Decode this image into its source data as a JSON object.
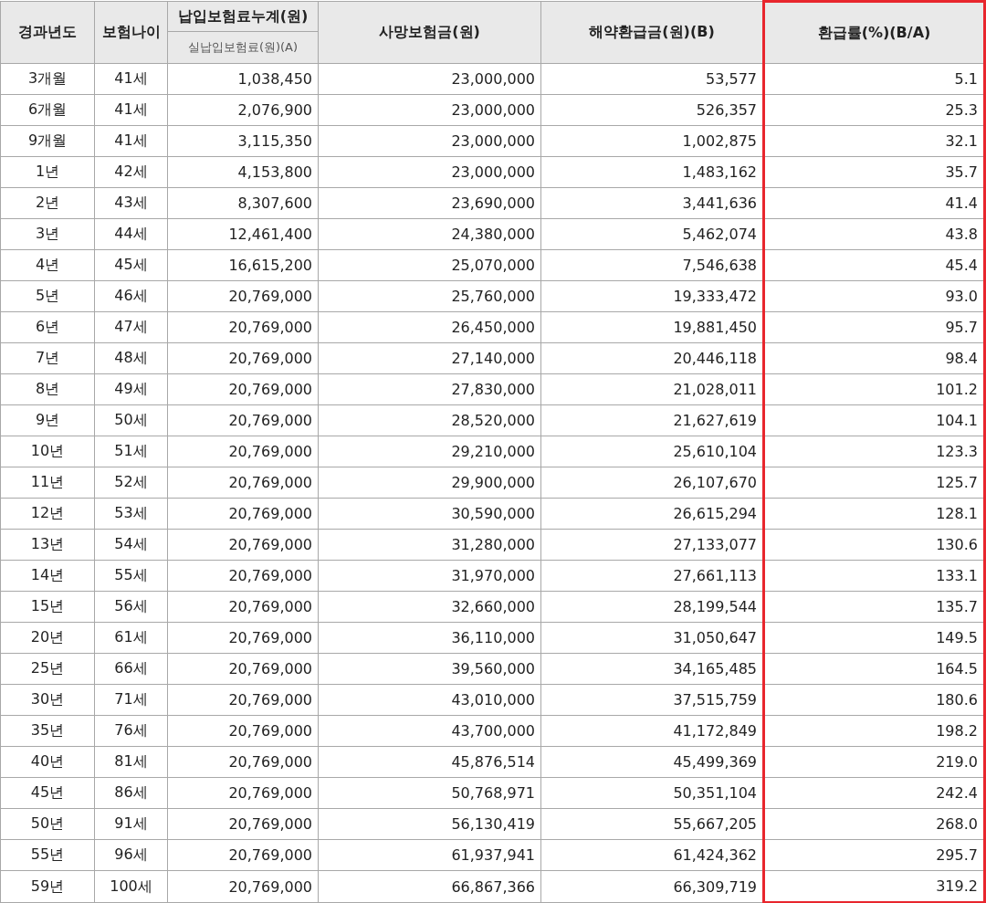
{
  "table": {
    "columns": [
      {
        "label": "경과년도",
        "highlighted": false
      },
      {
        "label": "보험나이",
        "highlighted": false
      },
      {
        "label": "납입보험료누계(원)",
        "sublabel": "실납입보험료(원)(A)",
        "highlighted": false
      },
      {
        "label": "사망보험금(원)",
        "highlighted": false
      },
      {
        "label": "해약환급금(원)(B)",
        "highlighted": false
      },
      {
        "label": "환급률(%)(B/A)",
        "highlighted": true
      }
    ],
    "rows": [
      [
        "3개월",
        "41세",
        "1,038,450",
        "23,000,000",
        "53,577",
        "5.1"
      ],
      [
        "6개월",
        "41세",
        "2,076,900",
        "23,000,000",
        "526,357",
        "25.3"
      ],
      [
        "9개월",
        "41세",
        "3,115,350",
        "23,000,000",
        "1,002,875",
        "32.1"
      ],
      [
        "1년",
        "42세",
        "4,153,800",
        "23,000,000",
        "1,483,162",
        "35.7"
      ],
      [
        "2년",
        "43세",
        "8,307,600",
        "23,690,000",
        "3,441,636",
        "41.4"
      ],
      [
        "3년",
        "44세",
        "12,461,400",
        "24,380,000",
        "5,462,074",
        "43.8"
      ],
      [
        "4년",
        "45세",
        "16,615,200",
        "25,070,000",
        "7,546,638",
        "45.4"
      ],
      [
        "5년",
        "46세",
        "20,769,000",
        "25,760,000",
        "19,333,472",
        "93.0"
      ],
      [
        "6년",
        "47세",
        "20,769,000",
        "26,450,000",
        "19,881,450",
        "95.7"
      ],
      [
        "7년",
        "48세",
        "20,769,000",
        "27,140,000",
        "20,446,118",
        "98.4"
      ],
      [
        "8년",
        "49세",
        "20,769,000",
        "27,830,000",
        "21,028,011",
        "101.2"
      ],
      [
        "9년",
        "50세",
        "20,769,000",
        "28,520,000",
        "21,627,619",
        "104.1"
      ],
      [
        "10년",
        "51세",
        "20,769,000",
        "29,210,000",
        "25,610,104",
        "123.3"
      ],
      [
        "11년",
        "52세",
        "20,769,000",
        "29,900,000",
        "26,107,670",
        "125.7"
      ],
      [
        "12년",
        "53세",
        "20,769,000",
        "30,590,000",
        "26,615,294",
        "128.1"
      ],
      [
        "13년",
        "54세",
        "20,769,000",
        "31,280,000",
        "27,133,077",
        "130.6"
      ],
      [
        "14년",
        "55세",
        "20,769,000",
        "31,970,000",
        "27,661,113",
        "133.1"
      ],
      [
        "15년",
        "56세",
        "20,769,000",
        "32,660,000",
        "28,199,544",
        "135.7"
      ],
      [
        "20년",
        "61세",
        "20,769,000",
        "36,110,000",
        "31,050,647",
        "149.5"
      ],
      [
        "25년",
        "66세",
        "20,769,000",
        "39,560,000",
        "34,165,485",
        "164.5"
      ],
      [
        "30년",
        "71세",
        "20,769,000",
        "43,010,000",
        "37,515,759",
        "180.6"
      ],
      [
        "35년",
        "76세",
        "20,769,000",
        "43,700,000",
        "41,172,849",
        "198.2"
      ],
      [
        "40년",
        "81세",
        "20,769,000",
        "45,876,514",
        "45,499,369",
        "219.0"
      ],
      [
        "45년",
        "86세",
        "20,769,000",
        "50,768,971",
        "50,351,104",
        "242.4"
      ],
      [
        "50년",
        "91세",
        "20,769,000",
        "56,130,419",
        "55,667,205",
        "268.0"
      ],
      [
        "55년",
        "96세",
        "20,769,000",
        "61,937,941",
        "61,424,362",
        "295.7"
      ],
      [
        "59년",
        "100세",
        "20,769,000",
        "66,867,366",
        "66,309,719",
        "319.2"
      ]
    ]
  }
}
